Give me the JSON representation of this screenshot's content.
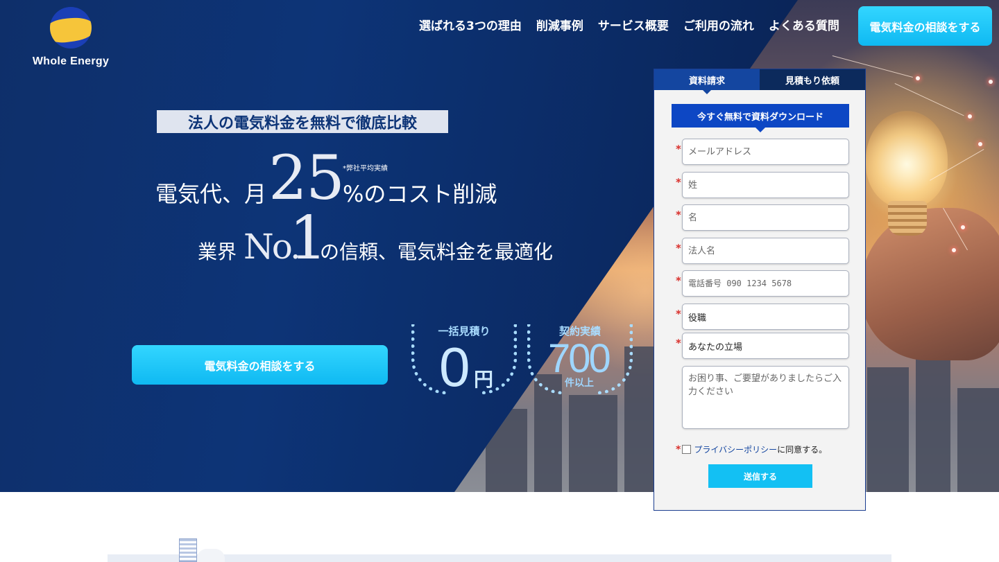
{
  "brand": {
    "name": "Whole Energy"
  },
  "nav": {
    "items": [
      "選ばれる3つの理由",
      "削減事例",
      "サービス概要",
      "ご利用の流れ",
      "よくある質問"
    ],
    "cta": "電気料金の相談をする"
  },
  "hero": {
    "tagline": "法人の電気料金を無料で徹底比較",
    "line1_pre": "電気代、月",
    "line1_number": "25",
    "line1_post": "%のコスト削減",
    "line1_note": "*弊社平均実績",
    "line2_pre": "業界",
    "line2_no": "No.",
    "line2_one": "1",
    "line2_post": "の信頼、電気料金を最適化",
    "cta": "電気料金の相談をする"
  },
  "awards": [
    {
      "title": "一括見積り",
      "value": "0",
      "unit": "円"
    },
    {
      "title": "契約実績",
      "value": "700",
      "unit": "件以上"
    }
  ],
  "form": {
    "tabs": [
      "資料請求",
      "見積もり依頼"
    ],
    "active_tab": 0,
    "heading": "今すぐ無料で資料ダウンロード",
    "required_mark": "*",
    "email_placeholder": "メールアドレス",
    "last_name_placeholder": "姓",
    "first_name_placeholder": "名",
    "company_placeholder": "法人名",
    "phone_placeholder": "電話番号 090 1234 5678",
    "position_value": "役職",
    "role_value": "あなたの立場",
    "message_placeholder": "お困り事、ご要望がありましたらご入力ください",
    "privacy_link": "プライバシーポリシー",
    "privacy_suffix": "に同意する。",
    "submit": "送信する"
  },
  "colors": {
    "hero_navy": "#0d3477",
    "cta_cyan": "#13c0f3",
    "form_blue": "#0d47c4",
    "required_red": "#d9302c",
    "logo_blue": "#1b3fb6",
    "logo_yellow": "#f6c53a"
  }
}
